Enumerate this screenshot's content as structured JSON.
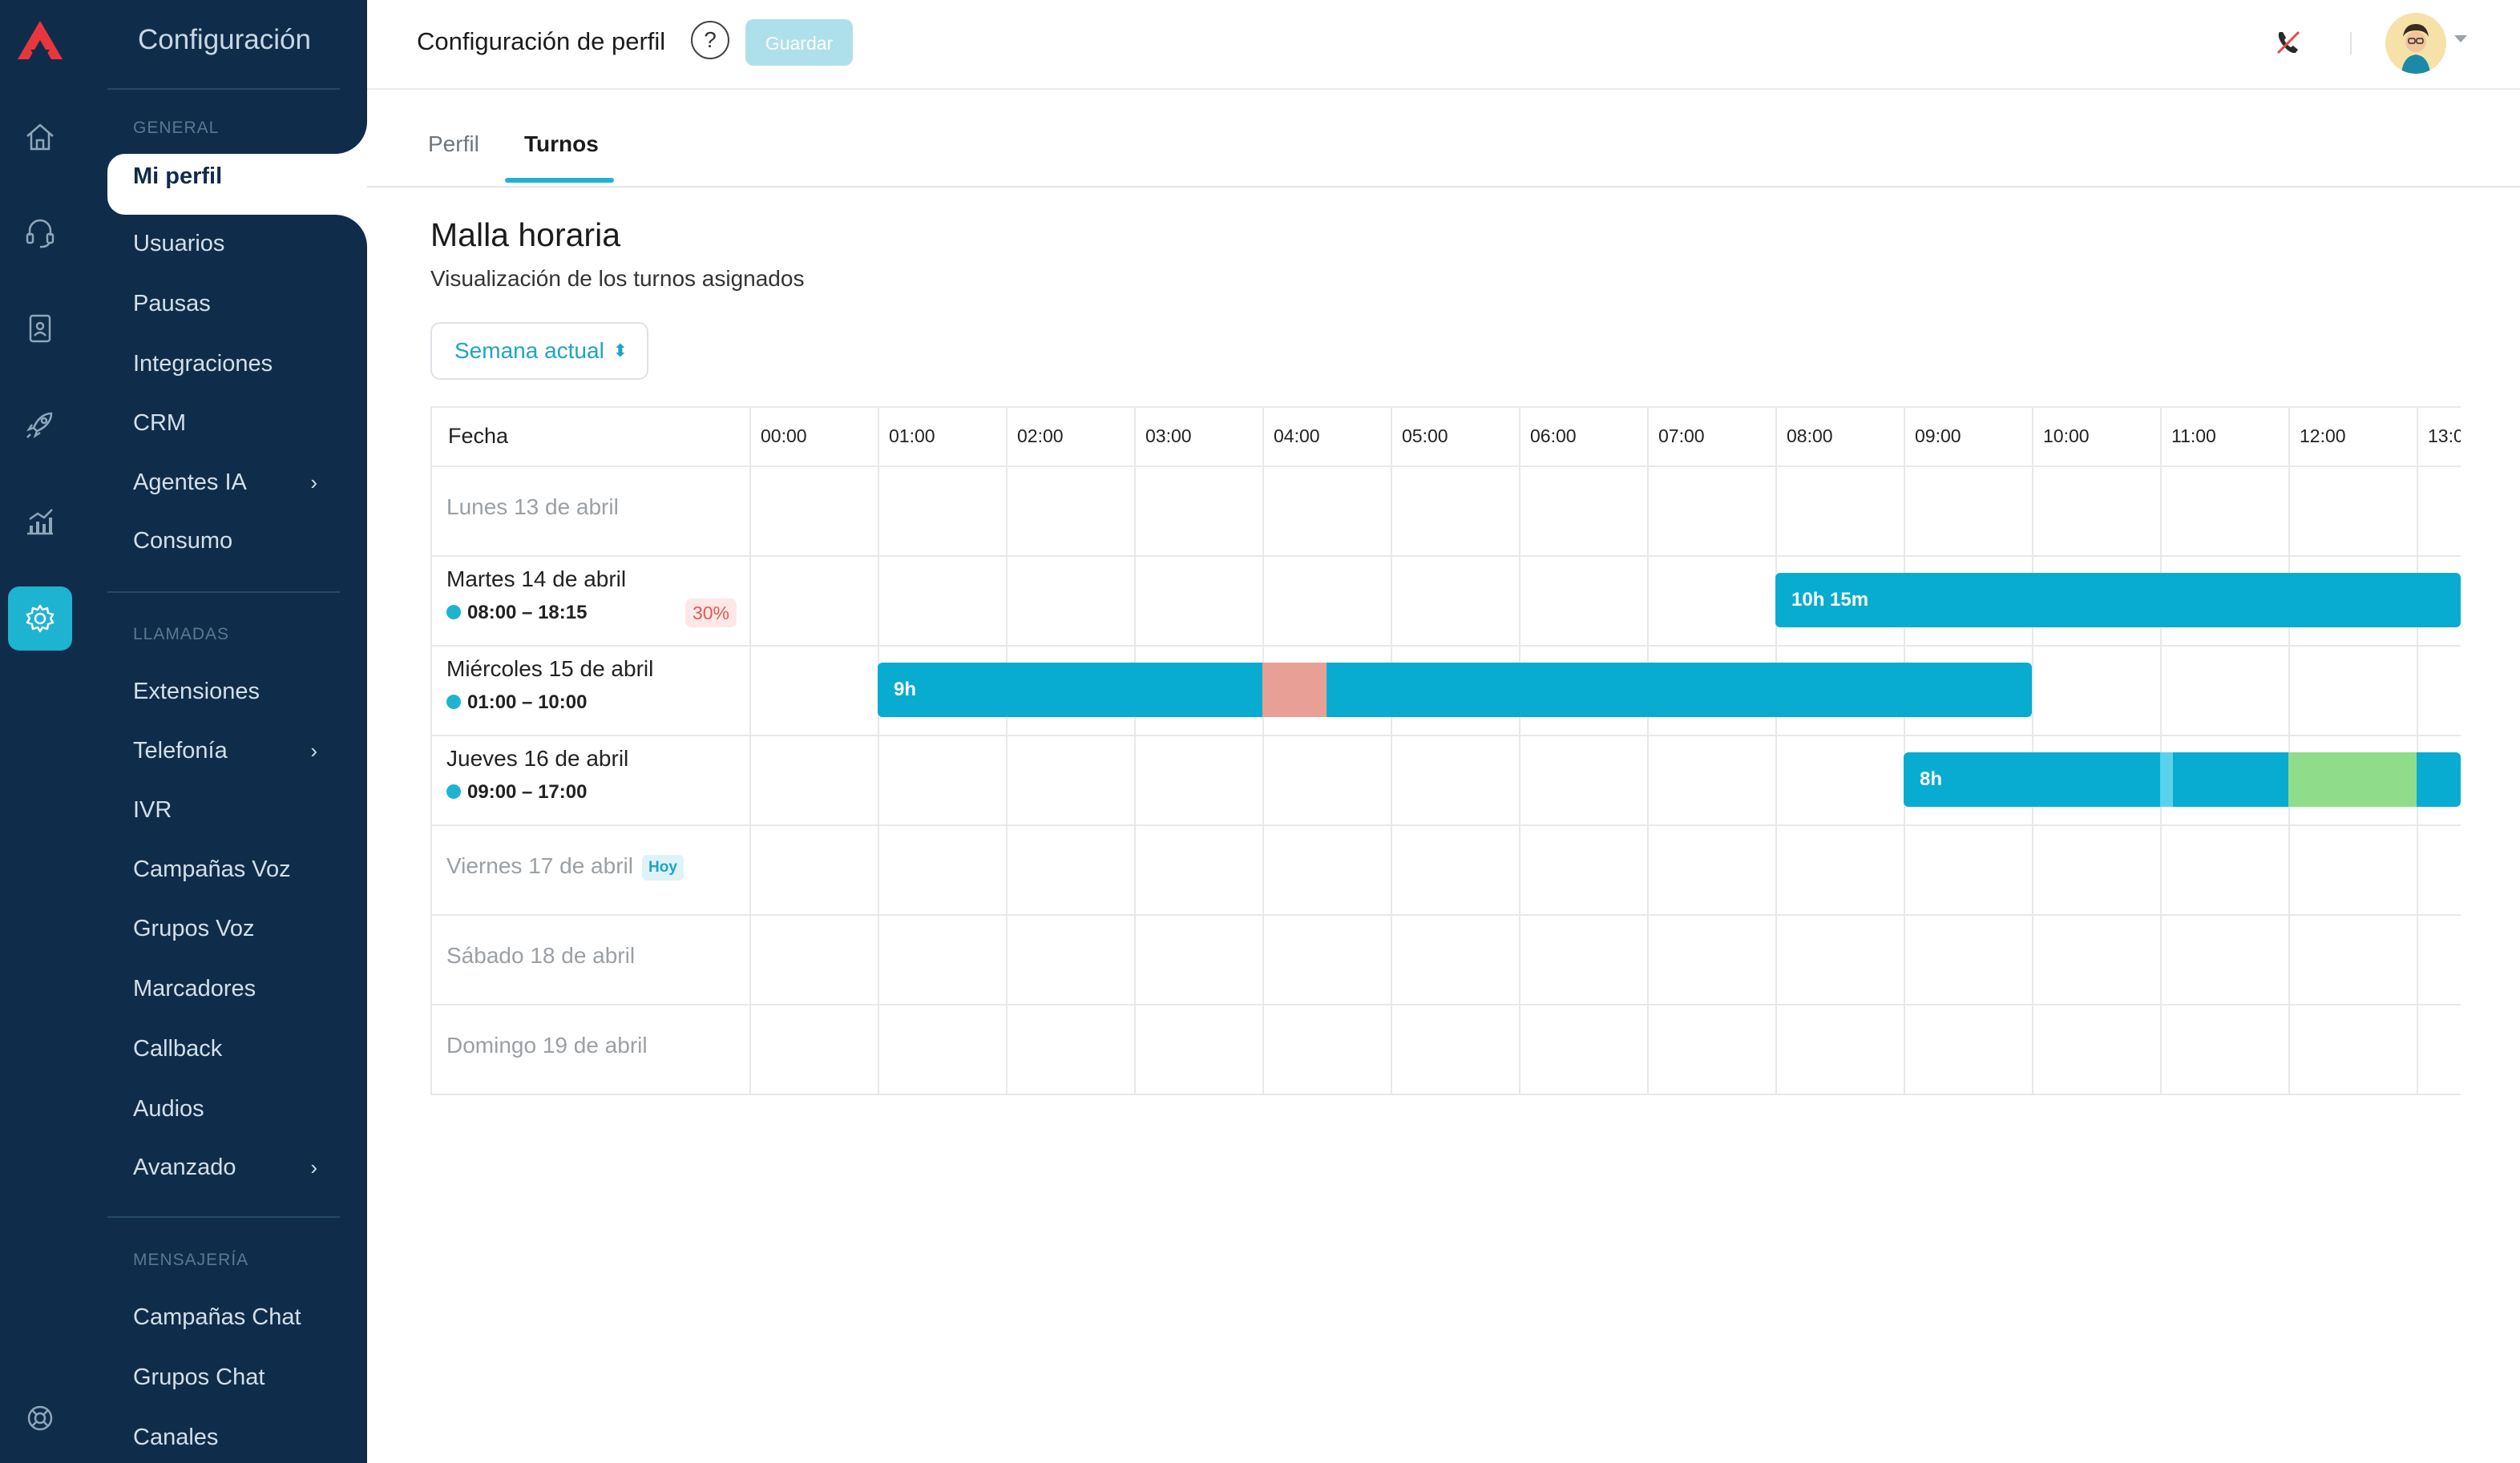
{
  "sidebar": {
    "title": "Configuración",
    "sections": {
      "general": "GENERAL",
      "llamadas": "LLAMADAS",
      "mensajeria": "MENSAJERÍA"
    },
    "items": [
      {
        "label": "Mi perfil"
      },
      {
        "label": "Usuarios"
      },
      {
        "label": "Pausas"
      },
      {
        "label": "Integraciones"
      },
      {
        "label": "CRM"
      },
      {
        "label": "Agentes IA"
      },
      {
        "label": "Consumo"
      },
      {
        "label": "Extensiones"
      },
      {
        "label": "Telefonía"
      },
      {
        "label": "IVR"
      },
      {
        "label": "Campañas Voz"
      },
      {
        "label": "Grupos Voz"
      },
      {
        "label": "Marcadores"
      },
      {
        "label": "Callback"
      },
      {
        "label": "Audios"
      },
      {
        "label": "Avanzado"
      },
      {
        "label": "Campañas Chat"
      },
      {
        "label": "Grupos Chat"
      },
      {
        "label": "Canales"
      }
    ],
    "chevron": "›"
  },
  "rail": {
    "icons": [
      "logo-icon",
      "home-icon",
      "headset-icon",
      "contacts-icon",
      "rocket-icon",
      "analytics-icon",
      "gear-icon",
      "lifebuoy-icon"
    ],
    "active_color": "#1fb3d2"
  },
  "header": {
    "title": "Configuración de perfil",
    "help": "?",
    "save_label": "Guardar"
  },
  "tabs": [
    {
      "label": "Perfil"
    },
    {
      "label": "Turnos"
    }
  ],
  "schedule": {
    "title": "Malla horaria",
    "subtitle": "Visualización de los turnos asignados",
    "week_select": "Semana actual",
    "column_header": "Fecha",
    "hours": [
      "00:00",
      "01:00",
      "02:00",
      "03:00",
      "04:00",
      "05:00",
      "06:00",
      "07:00",
      "08:00",
      "09:00",
      "10:00",
      "11:00",
      "12:00",
      "13:0"
    ],
    "days": [
      {
        "label": "Lunes 13 de abril",
        "time": ""
      },
      {
        "label": "Martes 14 de abril",
        "time": "08:00 – 18:15",
        "badge": "30%"
      },
      {
        "label": "Miércoles 15 de abril",
        "time": "01:00 – 10:00"
      },
      {
        "label": "Jueves 16 de abril",
        "time": "09:00 – 17:00"
      },
      {
        "label": "Viernes 17 de abril",
        "time": "",
        "badge": "Hoy"
      },
      {
        "label": "Sábado 18 de abril",
        "time": ""
      },
      {
        "label": "Domingo 19 de abril",
        "time": ""
      }
    ],
    "shifts": [
      {
        "day": "Martes 14 de abril",
        "label": "10h 15m",
        "start": 8.0,
        "end": 18.25
      },
      {
        "day": "Miércoles 15 de abril",
        "label": "9h",
        "start": 1.0,
        "end": 10.0,
        "break": {
          "start": 4.0,
          "end": 4.5,
          "color": "#e8a096"
        }
      },
      {
        "day": "Jueves 16 de abril",
        "label": "8h",
        "start": 9.0,
        "end": 17.0,
        "breaks": [
          {
            "start": 11.0,
            "end": 11.1,
            "color": "#5bd2ec"
          },
          {
            "start": 12.0,
            "end": 13.0,
            "color": "#8fdd8a"
          }
        ]
      }
    ],
    "colors": {
      "shift": "#08acd0",
      "accent": "#1fb3d2"
    }
  }
}
